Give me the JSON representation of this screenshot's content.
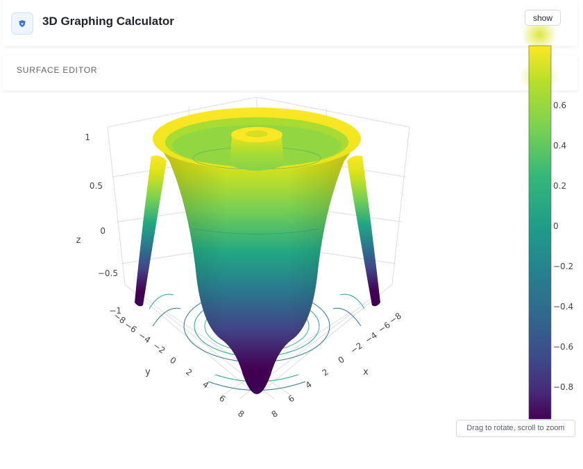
{
  "app": {
    "title": "3D Graphing Calculator",
    "logo_icon": "shield-icon",
    "accent": "#3b76d4"
  },
  "editor": {
    "label": "SURFACE EDITOR",
    "show_label": "show"
  },
  "hint": "Drag to rotate, scroll to zoom",
  "chart_data": {
    "type": "surface",
    "title": "",
    "colorscale": "Viridis",
    "axes": {
      "x": {
        "label": "x",
        "ticks": [
          "−8",
          "−6",
          "−4",
          "−2",
          "0",
          "2",
          "4",
          "6",
          "8"
        ]
      },
      "y": {
        "label": "y",
        "ticks": [
          "−8",
          "−6",
          "−4",
          "−2",
          "0",
          "2",
          "4",
          "6",
          "8"
        ]
      },
      "z": {
        "label": "z",
        "ticks": [
          "−1",
          "−0.5",
          "0",
          "0.5",
          "1"
        ],
        "range": [
          -1,
          1
        ]
      }
    },
    "colorbar": {
      "range": [
        -1,
        1
      ],
      "ticks": [
        "0.6",
        "0.4",
        "0.2",
        "0",
        "−0.2",
        "−0.4",
        "−0.6",
        "−0.8"
      ]
    },
    "contours_projected": true
  }
}
